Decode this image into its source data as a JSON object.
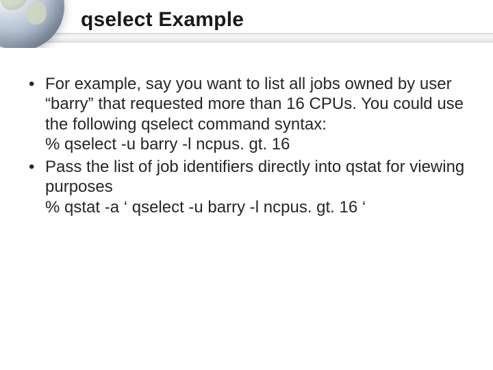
{
  "title": "qselect Example",
  "bullets": [
    {
      "text": "For example, say you want to list all jobs owned by user “barry” that requested more than 16 CPUs. You could use the following qselect command syntax:",
      "sub": "% qselect -u barry -l ncpus. gt. 16"
    },
    {
      "text": "Pass the list of job identifiers directly into qstat for viewing purposes",
      "sub": "% qstat -a ‘ qselect -u barry -l ncpus. gt. 16 ‘"
    }
  ]
}
